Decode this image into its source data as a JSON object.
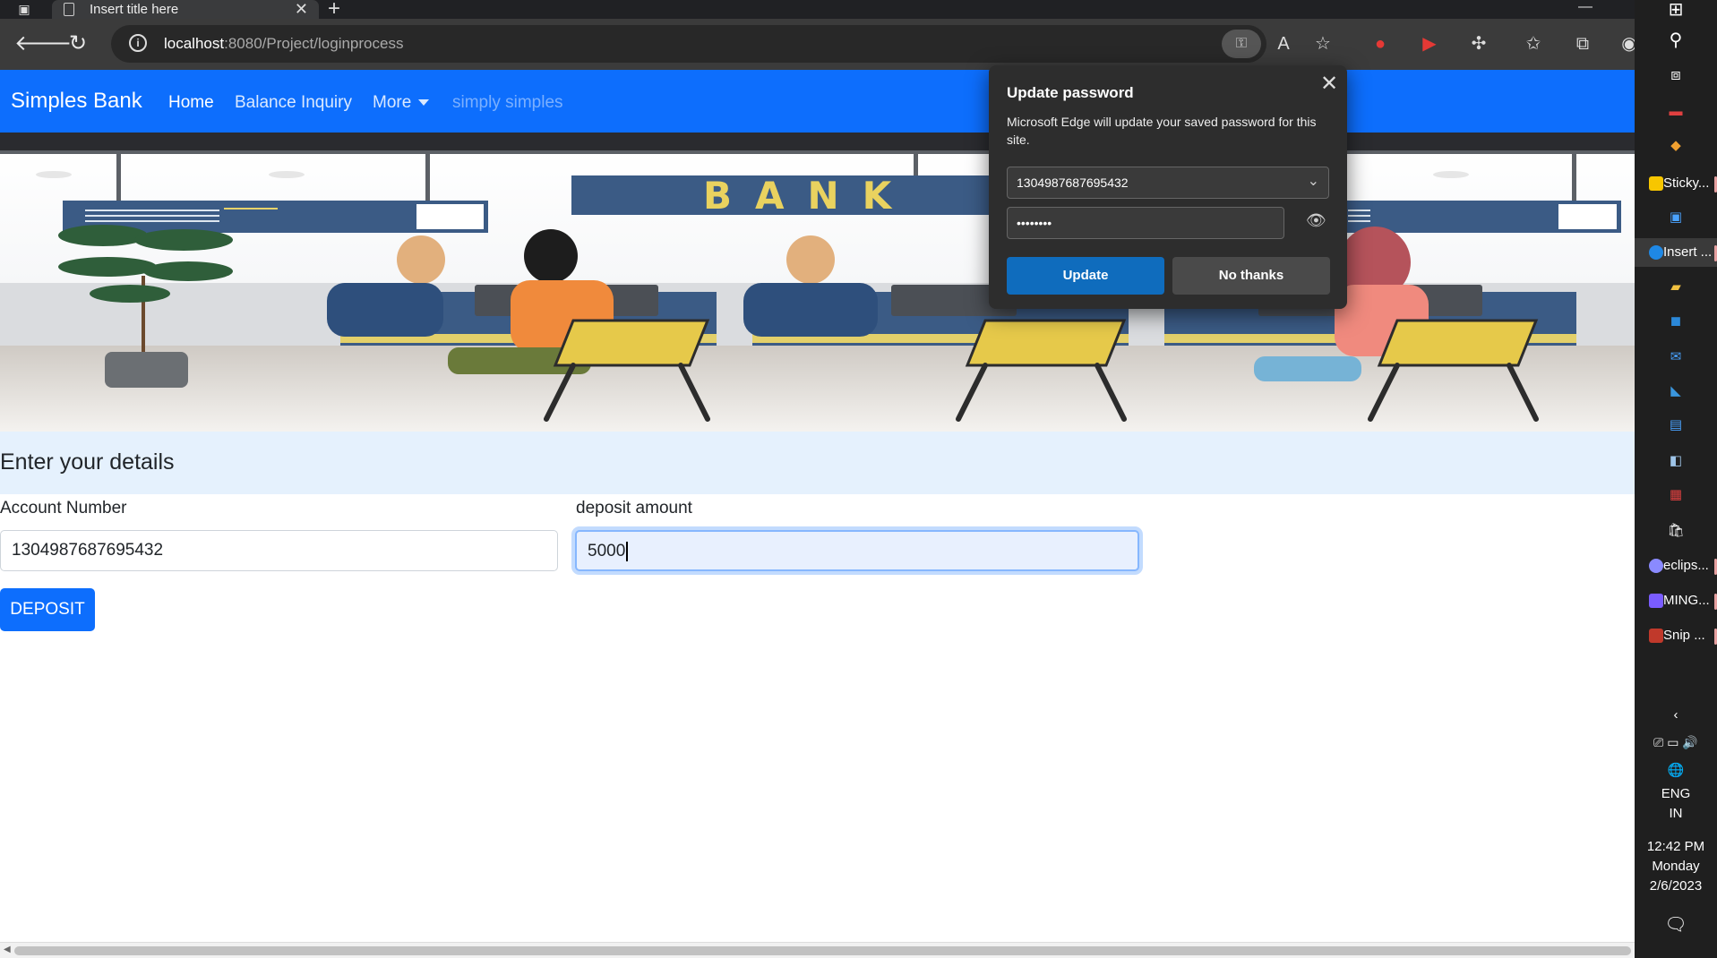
{
  "browser": {
    "tab": {
      "title": "Insert title here",
      "close": "✕"
    },
    "new_tab": "+",
    "window_min": "—",
    "url_host": "localhost",
    "url_rest": ":8080/Project/loginprocess"
  },
  "site": {
    "brand": "Simples Bank",
    "nav": {
      "home": "Home",
      "balance": "Balance Inquiry",
      "more": "More",
      "disabled": "simply simples"
    },
    "hero_bank_text": "BANK"
  },
  "form": {
    "heading": "Enter your details",
    "account_label": "Account Number",
    "account_value": "1304987687695432",
    "deposit_label": "deposit amount",
    "deposit_value": "5000",
    "submit": "DEPOSIT"
  },
  "popup": {
    "title": "Update password",
    "description": "Microsoft Edge will update your saved password for this site.",
    "username": "1304987687695432",
    "password_mask": "••••••••",
    "update": "Update",
    "no_thanks": "No thanks"
  },
  "taskbar": {
    "apps": [
      {
        "label": "Sticky...",
        "color": "#f7c600"
      },
      {
        "label": "Insert ...",
        "color": "#1f88e5"
      },
      {
        "label": "eclips...",
        "color": "#8a8aff"
      },
      {
        "label": "MING...",
        "color": "#7a5cff"
      },
      {
        "label": "Snip ...",
        "color": "#c0392b"
      }
    ],
    "lang": "ENG",
    "region": "IN",
    "time": "12:42 PM",
    "day": "Monday",
    "date": "2/6/2023"
  },
  "colors": {
    "navbar": "#0d6efd",
    "section_bg": "#e5f1fd",
    "popup_bg": "#2d2d2d",
    "popup_primary": "#0f6cbd"
  }
}
